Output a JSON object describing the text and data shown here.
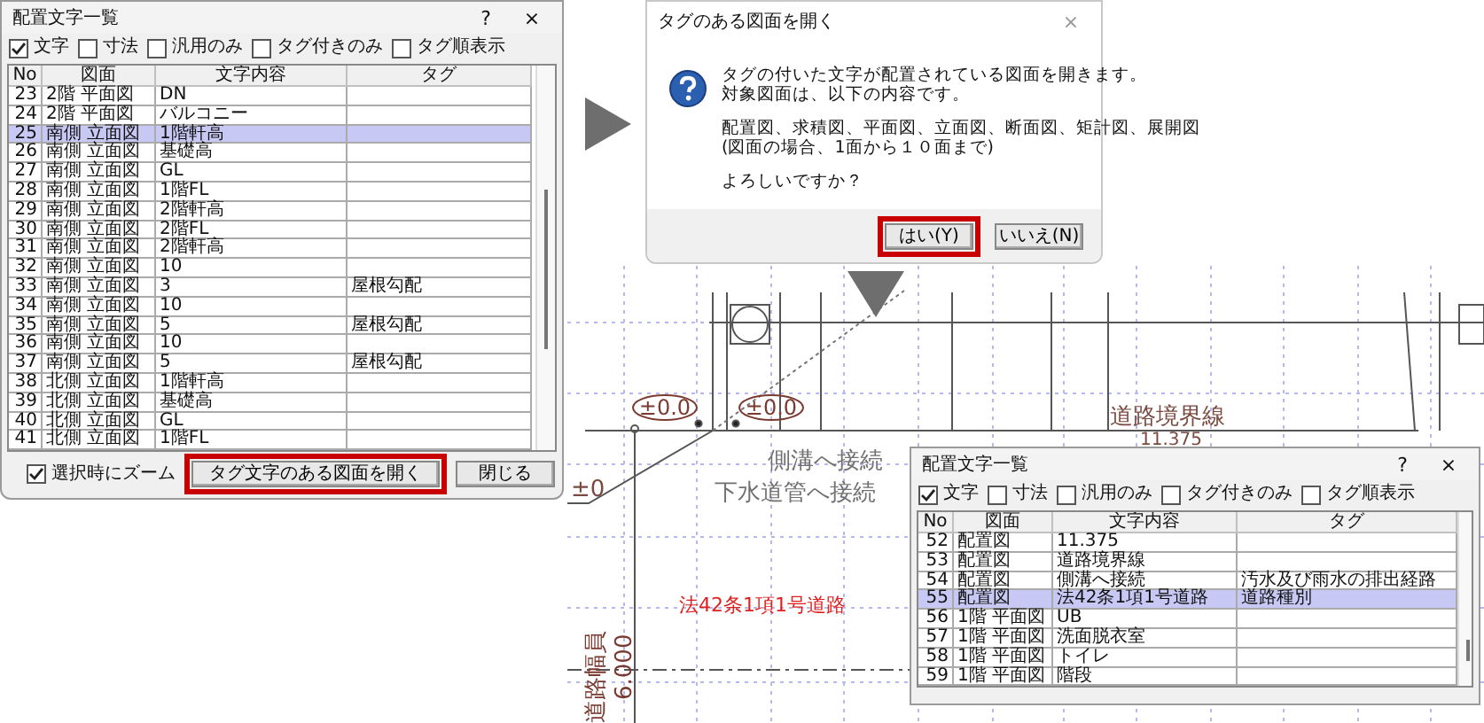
{
  "list_dialog": {
    "title": "配置文字一覧",
    "help": "?",
    "close": "×",
    "filters": [
      {
        "label": "文字",
        "checked": true
      },
      {
        "label": "寸法",
        "checked": false
      },
      {
        "label": "汎用のみ",
        "checked": false
      },
      {
        "label": "タグ付きのみ",
        "checked": false
      },
      {
        "label": "タグ順表示",
        "checked": false
      }
    ],
    "columns": [
      "No",
      "図面",
      "文字内容",
      "タグ"
    ],
    "rows": [
      {
        "no": "23",
        "drawing": "2階 平面図",
        "text": "DN",
        "tag": "",
        "selected": false
      },
      {
        "no": "24",
        "drawing": "2階 平面図",
        "text": "バルコニー",
        "tag": "",
        "selected": false
      },
      {
        "no": "25",
        "drawing": "南側 立面図",
        "text": "1階軒高",
        "tag": "",
        "selected": true
      },
      {
        "no": "26",
        "drawing": "南側 立面図",
        "text": "基礎高",
        "tag": "",
        "selected": false
      },
      {
        "no": "27",
        "drawing": "南側 立面図",
        "text": "GL",
        "tag": "",
        "selected": false
      },
      {
        "no": "28",
        "drawing": "南側 立面図",
        "text": "1階FL",
        "tag": "",
        "selected": false
      },
      {
        "no": "29",
        "drawing": "南側 立面図",
        "text": "2階軒高",
        "tag": "",
        "selected": false
      },
      {
        "no": "30",
        "drawing": "南側 立面図",
        "text": "2階FL",
        "tag": "",
        "selected": false
      },
      {
        "no": "31",
        "drawing": "南側 立面図",
        "text": "2階軒高",
        "tag": "",
        "selected": false
      },
      {
        "no": "32",
        "drawing": "南側 立面図",
        "text": "10",
        "tag": "",
        "selected": false
      },
      {
        "no": "33",
        "drawing": "南側 立面図",
        "text": "3",
        "tag": "屋根勾配",
        "selected": false
      },
      {
        "no": "34",
        "drawing": "南側 立面図",
        "text": "10",
        "tag": "",
        "selected": false
      },
      {
        "no": "35",
        "drawing": "南側 立面図",
        "text": "5",
        "tag": "屋根勾配",
        "selected": false
      },
      {
        "no": "36",
        "drawing": "南側 立面図",
        "text": "10",
        "tag": "",
        "selected": false
      },
      {
        "no": "37",
        "drawing": "南側 立面図",
        "text": "5",
        "tag": "屋根勾配",
        "selected": false
      },
      {
        "no": "38",
        "drawing": "北側 立面図",
        "text": "1階軒高",
        "tag": "",
        "selected": false
      },
      {
        "no": "39",
        "drawing": "北側 立面図",
        "text": "基礎高",
        "tag": "",
        "selected": false
      },
      {
        "no": "40",
        "drawing": "北側 立面図",
        "text": "GL",
        "tag": "",
        "selected": false
      },
      {
        "no": "41",
        "drawing": "北側 立面図",
        "text": "1階FL",
        "tag": "",
        "selected": false
      }
    ],
    "zoom_option": {
      "label": "選択時にズーム",
      "checked": true
    },
    "buttons": [
      {
        "label": "タグ文字のある図面を開く",
        "highlighted": true
      },
      {
        "label": "閉じる",
        "highlighted": false
      }
    ]
  },
  "confirm_dialog": {
    "title": "タグのある図面を開く",
    "close": "×",
    "paragraphs": [
      [
        "タグの付いた文字が配置されている図面を開きます。",
        "対象図面は、以下の内容です。"
      ],
      [
        "配置図、求積図、平面図、立面図、断面図、矩計図、展開図",
        "(図面の場合、1面から１０面まで)"
      ],
      [
        "よろしいですか？"
      ]
    ],
    "buttons": [
      {
        "label": "はい(Y)",
        "highlighted": true
      },
      {
        "label": "いいえ(N)",
        "highlighted": false
      }
    ]
  },
  "drawing": {
    "labels": [
      {
        "kind": "level",
        "text": "±0.0"
      },
      {
        "kind": "level",
        "text": "±0.0"
      },
      {
        "kind": "dim",
        "text": "±0"
      },
      {
        "kind": "note",
        "text": "側溝へ接続"
      },
      {
        "kind": "note",
        "text": "下水道管へ接続"
      },
      {
        "kind": "road",
        "text": "法42条1項1号道路"
      },
      {
        "kind": "vertical",
        "text": "道路幅員"
      },
      {
        "kind": "vertical",
        "text": "6.000"
      },
      {
        "kind": "dim",
        "text": "道路境界線"
      },
      {
        "kind": "dim",
        "text": "11.375"
      }
    ]
  },
  "list_dialog_2": {
    "title": "配置文字一覧",
    "help": "?",
    "close": "×",
    "filters": [
      {
        "label": "文字",
        "checked": true
      },
      {
        "label": "寸法",
        "checked": false
      },
      {
        "label": "汎用のみ",
        "checked": false
      },
      {
        "label": "タグ付きのみ",
        "checked": false
      },
      {
        "label": "タグ順表示",
        "checked": false
      }
    ],
    "columns": [
      "No",
      "図面",
      "文字内容",
      "タグ"
    ],
    "rows": [
      {
        "no": "52",
        "drawing": "配置図",
        "text": "11.375",
        "tag": "",
        "selected": false
      },
      {
        "no": "53",
        "drawing": "配置図",
        "text": "道路境界線",
        "tag": "",
        "selected": false
      },
      {
        "no": "54",
        "drawing": "配置図",
        "text": "側溝へ接続",
        "tag": "汚水及び雨水の排出経路",
        "selected": false
      },
      {
        "no": "55",
        "drawing": "配置図",
        "text": "法42条1項1号道路",
        "tag": "道路種別",
        "selected": true
      },
      {
        "no": "56",
        "drawing": "1階 平面図",
        "text": "UB",
        "tag": "",
        "selected": false
      },
      {
        "no": "57",
        "drawing": "1階 平面図",
        "text": "洗面脱衣室",
        "tag": "",
        "selected": false
      },
      {
        "no": "58",
        "drawing": "1階 平面図",
        "text": "トイレ",
        "tag": "",
        "selected": false
      },
      {
        "no": "59",
        "drawing": "1階 平面図",
        "text": "階段",
        "tag": "",
        "selected": false
      }
    ]
  }
}
